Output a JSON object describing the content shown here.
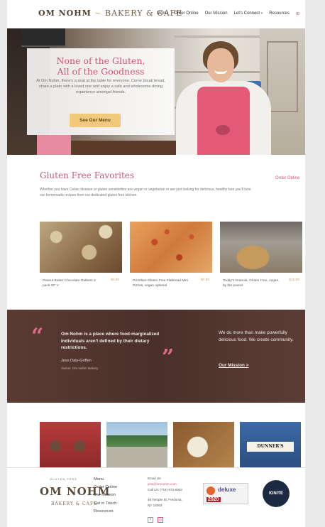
{
  "header": {
    "logo_main": "OM NOHM",
    "logo_sub": "BAKERY & CAFE",
    "nav": [
      "Menu",
      "Order Online",
      "Our Mission",
      "Let's Connect",
      "Resources"
    ]
  },
  "hero": {
    "title_line1": "None of the Gluten,",
    "title_line2": "All of the Goodness",
    "text": "At Om Nohm, there's a seat at the table for everyone. Come break bread, share a plate with a loved one and enjoy a safe and wholesome dining experience amongst friends.",
    "button": "See Our Menu"
  },
  "favorites": {
    "title": "Gluten Free Favorites",
    "link": "Order Online",
    "description": "Whether you have Celiac disease or gluten sensitivities are vegan or vegetarian or are just looking for delicious, healthy fare you'll love our homemade recipes from our dedicated gluten free kitchen.",
    "products": [
      {
        "name": "Peanut Butter Chocolate Oatbars 2 pack GF V",
        "price": "$4.00"
      },
      {
        "name": "Pizzettes-Gluten Free Flatbread Mini Pizzas, vegan optional",
        "price": "$7.50"
      },
      {
        "name": "Today's Granola, Gluten Free, vegan, by the pound",
        "price": "$12.00"
      }
    ]
  },
  "quote": {
    "text": "Om Nohm is a place where food-marginalized individuals aren't defined by their dietary restrictions.",
    "author": "Jess Daly-Griffen",
    "role": "Owner, Om Nohm Bakery",
    "right_text": "We do more than make powerfully delicious food. We create community.",
    "link": "Our Mission >"
  },
  "gallery": {
    "book_label": "DUNNER'S"
  },
  "footer": {
    "logo_top": "GLUTEN FREE",
    "logo_main": "OM NOHM",
    "logo_sub": "BAKERY & CAFE",
    "menu": [
      "Menu",
      "Order Online",
      "Our Mission",
      "Get in Touch",
      "Resources"
    ],
    "email_label": "Email Us:",
    "email": "jess@omnohm.com",
    "call": "Call Us: (716) 672-8003",
    "address1": "46 Temple St, Fredonia,",
    "address2": "NY 14063",
    "badge_brand": "deluxe",
    "badge_year": "2020",
    "ignite": "IGNITE"
  },
  "colors": {
    "accent_pink": "#d2527c",
    "button_gold": "#f2c97a",
    "quote_band": "#4a302a"
  }
}
